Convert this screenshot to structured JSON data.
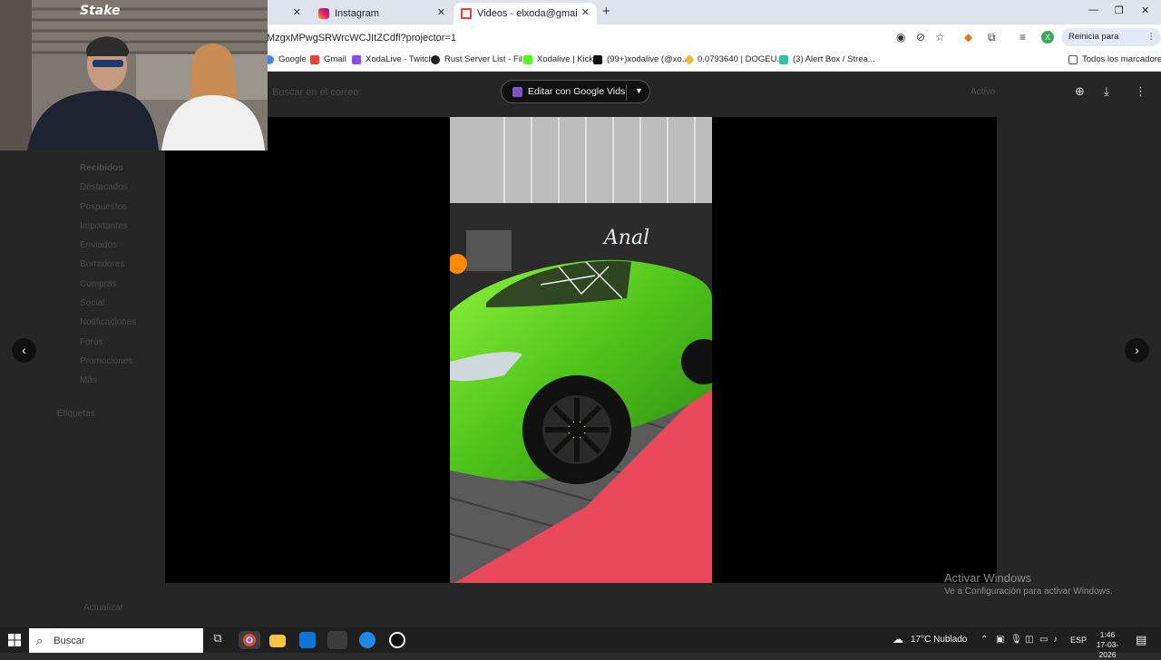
{
  "browser": {
    "tabs": [
      {
        "label": "",
        "active": false
      },
      {
        "label": "Instagram",
        "active": false
      },
      {
        "label": "Videos - elxoda@gmail.com - G",
        "active": true
      }
    ],
    "url": "MzgxMPwgSRWrcWCJItZCdfl?projector=1",
    "update_button": "Reinicia para actualizar",
    "profile_letter": "X",
    "bookmarks": [
      {
        "label": "Google",
        "icon": "google-icon"
      },
      {
        "label": "Gmail",
        "icon": "gmail-icon"
      },
      {
        "label": "XodaLive - Twitch",
        "icon": "twitch-icon"
      },
      {
        "label": "Rust Server List - Fil...",
        "icon": "rust-icon"
      },
      {
        "label": "Xodalive | Kick",
        "icon": "kick-icon"
      },
      {
        "label": "(99+)xodalive (@xo...",
        "icon": "tiktok-icon"
      },
      {
        "label": "0.0793640 | DOGEU...",
        "icon": "binance-icon"
      },
      {
        "label": "(3) Alert Box / Strea...",
        "icon": "streamlabs-icon"
      }
    ],
    "all_bookmarks": "Todos los marcadores"
  },
  "gmail": {
    "search_placeholder": "Buscar en el correo",
    "status": "Activo",
    "sidebar": [
      "Recibidos",
      "Destacados",
      "Pospuestos",
      "Importantes",
      "Enviados",
      "Borradores",
      "Compras",
      "Social",
      "Notificaciones",
      "Foros",
      "Promociones",
      "Más"
    ],
    "labels_heading": "Etiquetas",
    "upgrade": "Actualizar"
  },
  "viewer": {
    "edit_button": "Editar con Google Vids"
  },
  "windows_watermark": {
    "title": "Activar Windows",
    "subtitle": "Ve a Configuración para activar Windows."
  },
  "taskbar": {
    "search": "Buscar",
    "weather": "17°C  Nublado",
    "language": "ESP",
    "time": "1:46",
    "date": "17-03-2026"
  },
  "webcam": {
    "overlay_text": "Stake"
  }
}
